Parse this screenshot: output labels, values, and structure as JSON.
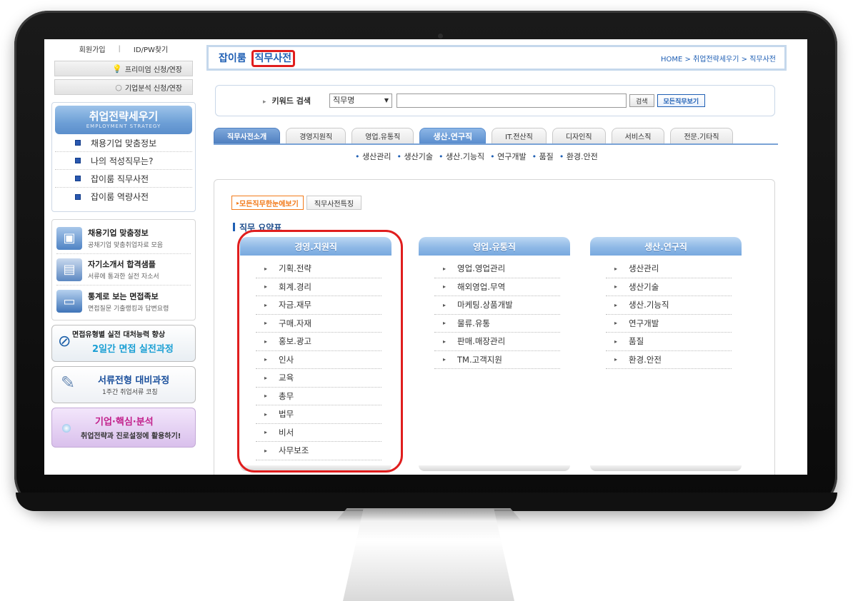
{
  "sidebar": {
    "login": {
      "join": "회원가입",
      "find": "ID/PW찾기"
    },
    "premium_btn": "프리미엄 신청/연장",
    "analysis_btn": "기업분석 신청/연장",
    "strategy_banner": {
      "title": "취업전략세우기",
      "subtitle": "EMPLOYMENT STRATEGY"
    },
    "strategy_items": [
      {
        "label": "채용기업 맞춤정보"
      },
      {
        "label": "나의 적성직무는?"
      },
      {
        "label": "잡이룸 직무사전"
      },
      {
        "label": "잡이룸 역량사전"
      }
    ],
    "promos": [
      {
        "title": "채용기업 맞춤정보",
        "desc": "공채기업 맞춤취업자료 모음"
      },
      {
        "title": "자기소개서 합격샘플",
        "desc": "서류에 통과한 실전 자소서"
      },
      {
        "title": "통계로 보는 면접족보",
        "desc": "면접질문 기출랭킹과 답변요령"
      }
    ],
    "interview_banner": {
      "line1": "면접유형별 실전 대처능력 향상",
      "line2": "2일간 면접 실전과정"
    },
    "document_banner": {
      "line1": "서류전형 대비과정",
      "line2": "1주간 취업서류 코칭"
    },
    "analysis_banner": {
      "line1": "기업·핵심·분석",
      "line2": "취업전략과 진로설정에 활용하기!"
    }
  },
  "header": {
    "title_prefix": "잡이룸",
    "title_highlight": "직무사전",
    "breadcrumb": "HOME > 취업전략세우기 > 직무사전"
  },
  "search": {
    "label": "키워드 검색",
    "select_value": "직무명",
    "input_value": "",
    "search_button": "검색",
    "view_all_button": "모든직무보기"
  },
  "tabs": [
    {
      "label": "직무사전소개"
    },
    {
      "label": "경영지원직"
    },
    {
      "label": "영업.유통직"
    },
    {
      "label": "생산.연구직"
    },
    {
      "label": "IT.전산직"
    },
    {
      "label": "디자인직"
    },
    {
      "label": "서비스직"
    },
    {
      "label": "전문.기타직"
    }
  ],
  "subnav": [
    "생산관리",
    "생산기술",
    "생산.기능직",
    "연구개발",
    "품질",
    "환경.안전"
  ],
  "content": {
    "tab_all": "모든직무한눈에보기",
    "tab_feature": "직무사전특징",
    "summary_title": "직무 요약표",
    "columns": [
      {
        "header": "경영.지원직",
        "items": [
          "기획.전략",
          "회계.경리",
          "자금.재무",
          "구매.자재",
          "홍보.광고",
          "인사",
          "교육",
          "총무",
          "법무",
          "비서",
          "사무보조"
        ]
      },
      {
        "header": "영업.유통직",
        "items": [
          "영업.영업관리",
          "해외영업.무역",
          "마케팅.상품개발",
          "물류.유통",
          "판매.매장관리",
          "TM.고객지원"
        ]
      },
      {
        "header": "생산.연구직",
        "items": [
          "생산관리",
          "생산기술",
          "생산.기능직",
          "연구개발",
          "품질",
          "환경.안전"
        ]
      }
    ]
  },
  "colors": {
    "accent_blue": "#1f5fb4",
    "highlight_red": "#e01e1e",
    "orange": "#f27a1a"
  }
}
